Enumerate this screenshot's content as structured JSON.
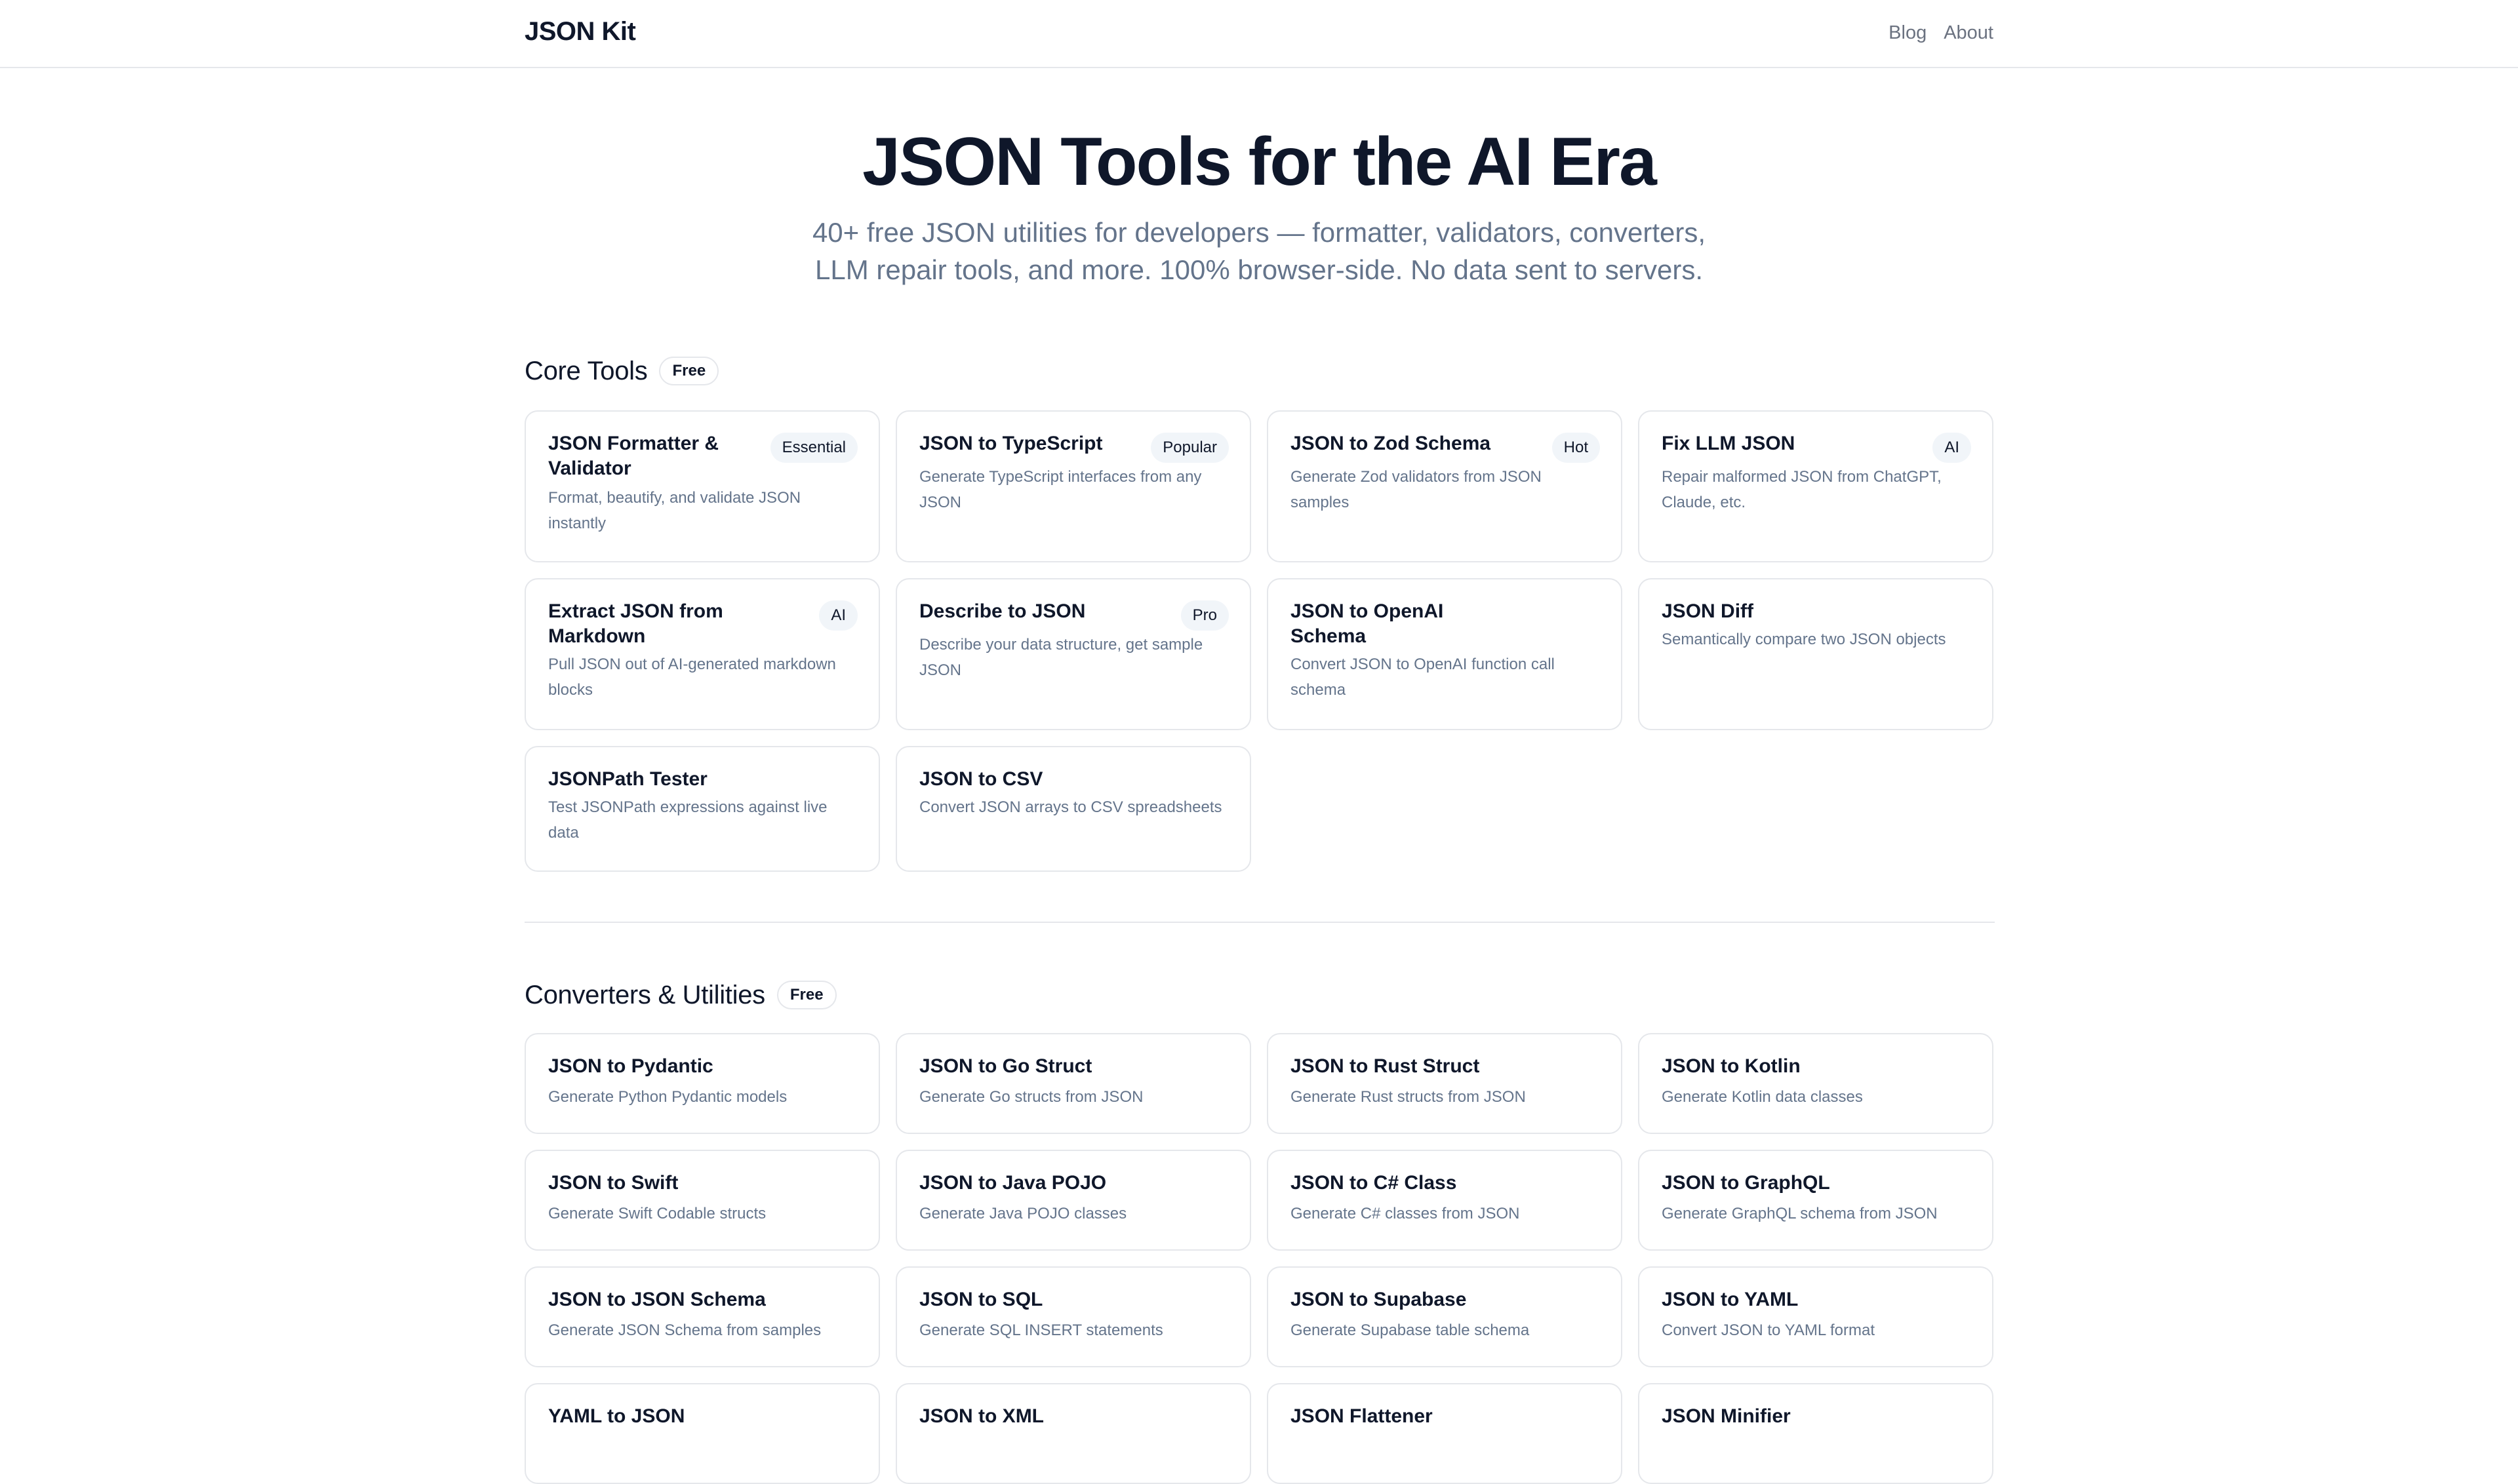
{
  "header": {
    "brand": "JSON Kit",
    "nav": [
      {
        "label": "Blog"
      },
      {
        "label": "About"
      }
    ]
  },
  "hero": {
    "title": "JSON Tools for the AI Era",
    "subtitle_line1": "40+ free JSON utilities for developers — formatter, validators, converters,",
    "subtitle_line2": "LLM repair tools, and more. 100% browser-side. No data sent to servers."
  },
  "core": {
    "title": "Core Tools",
    "badge": "Free",
    "cards": [
      {
        "title": "JSON Formatter & Validator",
        "desc": "Format, beautify, and validate JSON instantly",
        "tag": "Essential"
      },
      {
        "title": "JSON to TypeScript",
        "desc": "Generate TypeScript interfaces from any JSON",
        "tag": "Popular"
      },
      {
        "title": "JSON to Zod Schema",
        "desc": "Generate Zod validators from JSON samples",
        "tag": "Hot"
      },
      {
        "title": "Fix LLM JSON",
        "desc": "Repair malformed JSON from ChatGPT, Claude, etc.",
        "tag": "AI"
      },
      {
        "title": "Extract JSON from Markdown",
        "desc": "Pull JSON out of AI-generated markdown blocks",
        "tag": "AI"
      },
      {
        "title": "Describe to JSON",
        "desc": "Describe your data structure, get sample JSON",
        "tag": "Pro"
      },
      {
        "title": "JSON to OpenAI Schema",
        "desc": "Convert JSON to OpenAI function call schema",
        "tag": ""
      },
      {
        "title": "JSON Diff",
        "desc": "Semantically compare two JSON objects",
        "tag": ""
      },
      {
        "title": "JSONPath Tester",
        "desc": "Test JSONPath expressions against live data",
        "tag": ""
      },
      {
        "title": "JSON to CSV",
        "desc": "Convert JSON arrays to CSV spreadsheets",
        "tag": ""
      }
    ]
  },
  "converters": {
    "title": "Converters & Utilities",
    "badge": "Free",
    "cards": [
      {
        "title": "JSON to Pydantic",
        "desc": "Generate Python Pydantic models"
      },
      {
        "title": "JSON to Go Struct",
        "desc": "Generate Go structs from JSON"
      },
      {
        "title": "JSON to Rust Struct",
        "desc": "Generate Rust structs from JSON"
      },
      {
        "title": "JSON to Kotlin",
        "desc": "Generate Kotlin data classes"
      },
      {
        "title": "JSON to Swift",
        "desc": "Generate Swift Codable structs"
      },
      {
        "title": "JSON to Java POJO",
        "desc": "Generate Java POJO classes"
      },
      {
        "title": "JSON to C# Class",
        "desc": "Generate C# classes from JSON"
      },
      {
        "title": "JSON to GraphQL",
        "desc": "Generate GraphQL schema from JSON"
      },
      {
        "title": "JSON to JSON Schema",
        "desc": "Generate JSON Schema from samples"
      },
      {
        "title": "JSON to SQL",
        "desc": "Generate SQL INSERT statements"
      },
      {
        "title": "JSON to Supabase",
        "desc": "Generate Supabase table schema"
      },
      {
        "title": "JSON to YAML",
        "desc": "Convert JSON to YAML format"
      },
      {
        "title": "YAML to JSON",
        "desc": ""
      },
      {
        "title": "JSON to XML",
        "desc": ""
      },
      {
        "title": "JSON Flattener",
        "desc": ""
      },
      {
        "title": "JSON Minifier",
        "desc": ""
      }
    ]
  }
}
